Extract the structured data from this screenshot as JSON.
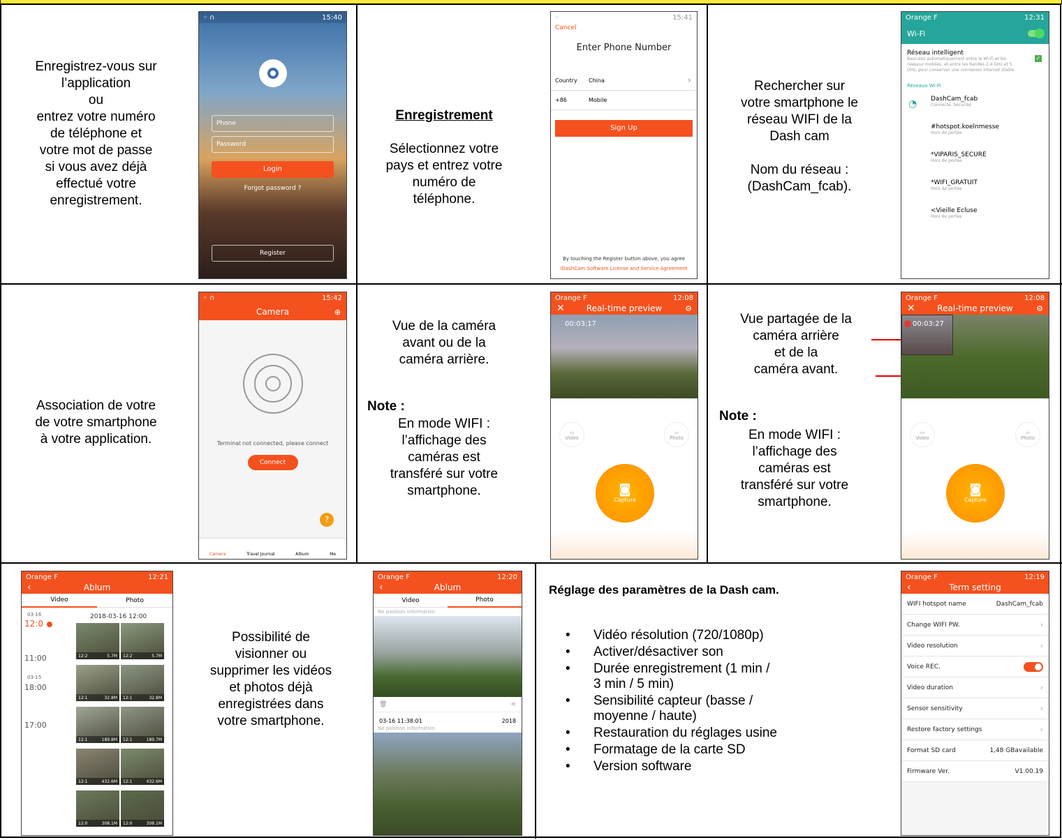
{
  "row1": {
    "cell1_lines": [
      "Enregistrez-vous sur",
      "l’application",
      "ou",
      "entrez votre numéro",
      "de téléphone et",
      "votre mot de passe",
      "si vous avez déjà",
      "effectué votre",
      "enregistrement."
    ],
    "login": {
      "time": "15:40",
      "phone_placeholder": "Phone",
      "password_placeholder": "Password",
      "login_label": "Login",
      "forgot": "Forgot password ?",
      "register": "Register"
    },
    "cell2_title": "Enregistrement",
    "cell2_lines": [
      "Sélectionnez votre",
      "pays et entrez votre",
      "numéro de",
      "téléphone."
    ],
    "signup": {
      "time": "15:41",
      "cancel": "Cancel",
      "title": "Enter Phone Number",
      "country_label": "Country",
      "country_value": "China",
      "code": "+86",
      "mobile": "Mobile",
      "signup_label": "Sign Up",
      "terms1": "By touching the Register button above, you agree",
      "terms2": "iDashCam Software License and Service Agreement"
    },
    "cell3_lines": [
      "Rechercher sur",
      "votre smartphone le",
      "réseau WIFI de la",
      "Dash cam",
      "",
      "Nom du réseau :",
      "(DashCam_fcab)."
    ],
    "wifi": {
      "carrier": "Orange F",
      "time": "12:31",
      "title": "Wi-Fi",
      "smart": "Réseau intelligent",
      "smart_desc": "Basculez automatiquement entre le Wi-Fi et les réseaux mobiles, et entre les bandes 2,4 GHz et 5 GHz, pour conserver une connexion Internet stable",
      "section": "Réseaux Wi-Fi",
      "networks": [
        {
          "name": "DashCam_fcab",
          "sub": "Connecté, Sécurisé"
        },
        {
          "name": "#hotspot.koelnmesse",
          "sub": "Hors de portée"
        },
        {
          "name": "*VIPARIS_SECURE",
          "sub": "Hors de portée"
        },
        {
          "name": "*WIFI_GRATUIT",
          "sub": "Hors de portée"
        },
        {
          "name": "<Vieille Ecluse",
          "sub": "Hors de portée"
        }
      ]
    }
  },
  "row2": {
    "cell1_lines": [
      "Association de votre",
      "de votre smartphone",
      "à votre application."
    ],
    "camera": {
      "time": "15:42",
      "title": "Camera",
      "msg": "Terminal not connected, please connect",
      "connect": "Connect",
      "tabs": [
        "Camera",
        "Travel Journal",
        "Album",
        "Me"
      ]
    },
    "cell2_lines": [
      "Vue de la caméra",
      "avant ou de la",
      "caméra arrière."
    ],
    "note": "Note :",
    "note_lines": [
      "En mode WIFI :",
      "l’affichage des",
      "caméras est",
      "transféré sur votre",
      "smartphone."
    ],
    "preview1": {
      "carrier": "Orange F",
      "time": "12:08",
      "battery": "51%",
      "title": "Real-time preview",
      "timer": "00:03:17",
      "video": "Video",
      "photo": "Photo",
      "capture": "Capture"
    },
    "cell3_lines": [
      "Vue partagée de la",
      "caméra arrière",
      "et de la",
      "caméra avant."
    ],
    "preview2": {
      "carrier": "Orange F",
      "time": "12:08",
      "battery": "51%",
      "title": "Real-time preview",
      "timer": "00:03:27",
      "video": "Video",
      "photo": "Photo",
      "capture": "Capture"
    }
  },
  "row3": {
    "album1": {
      "carrier": "Orange F",
      "time": "12:21",
      "battery": "47%",
      "title": "Ablum",
      "tab_video": "Video",
      "tab_photo": "Photo",
      "date1": "03-16",
      "time1": "12:0",
      "header": "2018-03-16 12:00",
      "time2": "11:00",
      "date2": "03-15",
      "time3": "18:00",
      "time4": "17:00",
      "thumbs": [
        [
          "12:2",
          "5.7M"
        ],
        [
          "12:2",
          "5.7M"
        ],
        [
          "12:1",
          "32.8M"
        ],
        [
          "12:1",
          "32.8M"
        ],
        [
          "12:1",
          "189.8M"
        ],
        [
          "12:1",
          "189.7M"
        ],
        [
          "12:1",
          "432.6M"
        ],
        [
          "12:1",
          "432.6M"
        ],
        [
          "12:0",
          "308.1M"
        ],
        [
          "12:0",
          "308.1M"
        ]
      ]
    },
    "cell2_lines": [
      "Possibilité de",
      "visionner ou",
      "supprimer les vidéos",
      "et photos déjà",
      "enregistrées dans",
      "votre smartphone."
    ],
    "album2": {
      "carrier": "Orange F",
      "time": "12:20",
      "battery": "47%",
      "title": "Ablum",
      "tab_video": "Video",
      "tab_photo": "Photo",
      "nopos": "No position information",
      "stamp": "03-16 11:38:01",
      "year": "2018"
    },
    "settings_title": "Réglage des paramètres de la Dash cam.",
    "bullets": [
      "Vidéo résolution (720/1080p)",
      "Activer/désactiver son",
      "Durée enregistrement (1 min /",
      "3 min / 5 min)",
      "Sensibilité capteur (basse /",
      "moyenne / haute)",
      "Restauration du réglages usine",
      "Formatage de la carte SD",
      "Version software"
    ],
    "term": {
      "carrier": "Orange F",
      "time": "12:19",
      "battery": "47%",
      "title": "Term setting",
      "rows": [
        {
          "label": "WIFI hotspot name",
          "value": "DashCam_fcab"
        },
        {
          "label": "Change WIFI PW.",
          "value": ""
        },
        {
          "label": "Video resolution",
          "value": ""
        },
        {
          "label": "Voice REC.",
          "value": ""
        },
        {
          "label": "Video duration",
          "value": ""
        },
        {
          "label": "Sensor sensitivity",
          "value": ""
        },
        {
          "label": "Restore factory settings",
          "value": ""
        },
        {
          "label": "Format SD card",
          "value": "1,48 GBavailable"
        },
        {
          "label": "Firmware Ver.",
          "value": "V1.00.19"
        }
      ]
    }
  }
}
